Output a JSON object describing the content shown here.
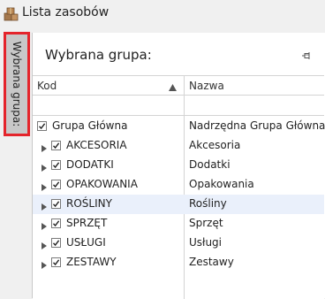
{
  "window": {
    "title": "Lista zasobów",
    "icon": "boxes-icon"
  },
  "side_tab": {
    "label": "Wybrana grupa:"
  },
  "panel": {
    "title": "Wybrana grupa:",
    "pin_icon": "pin-icon"
  },
  "grid": {
    "columns": {
      "kod": "Kod",
      "nazwa": "Nazwa"
    },
    "sort": "ascending",
    "rows": [
      {
        "kod": "Grupa Główna",
        "nazwa": "Nadrzędna Grupa Główna",
        "checked": true,
        "expandable": false
      },
      {
        "kod": "AKCESORIA",
        "nazwa": "Akcesoria",
        "checked": true,
        "expandable": true
      },
      {
        "kod": "DODATKI",
        "nazwa": "Dodatki",
        "checked": true,
        "expandable": true
      },
      {
        "kod": "OPAKOWANIA",
        "nazwa": "Opakowania",
        "checked": true,
        "expandable": true
      },
      {
        "kod": "ROŚLINY",
        "nazwa": "Rośliny",
        "checked": true,
        "expandable": true,
        "selected": true
      },
      {
        "kod": "SPRZĘT",
        "nazwa": "Sprzęt",
        "checked": true,
        "expandable": true
      },
      {
        "kod": "USŁUGI",
        "nazwa": "Usługi",
        "checked": true,
        "expandable": true
      },
      {
        "kod": "ZESTAWY",
        "nazwa": "Zestawy",
        "checked": true,
        "expandable": true
      }
    ]
  },
  "colors": {
    "highlight_border": "#e4242b",
    "selected_row": "#eaf0fb",
    "tab_background": "#c8c8c8"
  }
}
